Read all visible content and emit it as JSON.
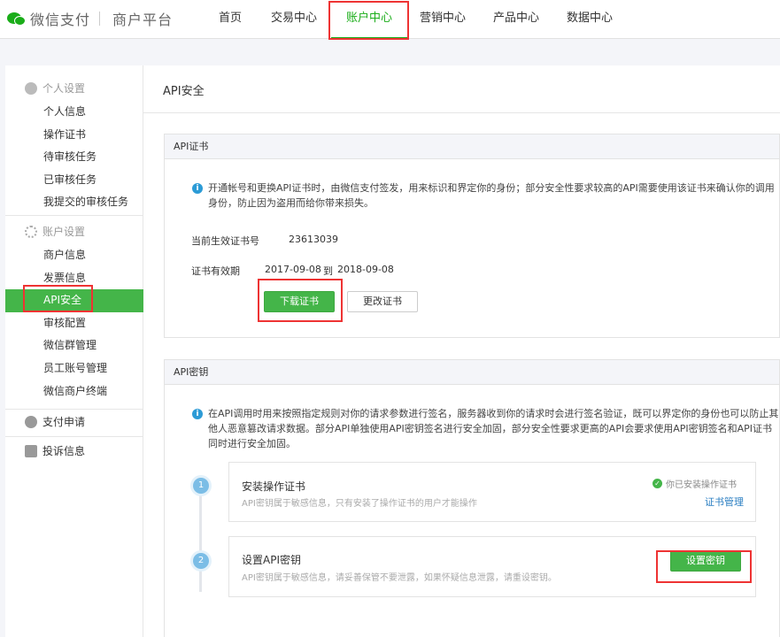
{
  "brand": {
    "name": "微信支付",
    "platform": "商户平台"
  },
  "nav": {
    "items": [
      "首页",
      "交易中心",
      "账户中心",
      "营销中心",
      "产品中心",
      "数据中心"
    ],
    "active_index": 2
  },
  "sidebar": {
    "personal": {
      "title": "个人设置",
      "items": [
        "个人信息",
        "操作证书",
        "待审核任务",
        "已审核任务",
        "我提交的审核任务"
      ]
    },
    "account": {
      "title": "账户设置",
      "items": [
        "商户信息",
        "发票信息",
        "API安全",
        "审核配置",
        "微信群管理",
        "员工账号管理",
        "微信商户终端"
      ],
      "active_index": 2
    },
    "payment_apply": "支付申请",
    "complaint": "投诉信息"
  },
  "main": {
    "title": "API安全",
    "cert": {
      "header": "API证书",
      "note_line1": "开通帐号和更换API证书时，由微信支付签发，用来标识和界定你的身份；部分安全性要求较高的API需要使用该证书来确认你的调用",
      "note_line2": "身份，防止因为盗用而给你带来损失。",
      "serial_label": "当前生效证书号",
      "serial_value": "23613039",
      "valid_label": "证书有效期",
      "valid_from": "2017-09-08",
      "valid_to_word": "到",
      "valid_to": "2018-09-08",
      "download_btn": "下载证书",
      "change_btn": "更改证书"
    },
    "key": {
      "header": "API密钥",
      "note_line1": "在API调用时用来按照指定规则对你的请求参数进行签名，服务器收到你的请求时会进行签名验证，既可以界定你的身份也可以防止其",
      "note_line2": "他人恶意篡改请求数据。部分API单独使用API密钥签名进行安全加固，部分安全性要求更高的API会要求使用API密钥签名和API证书",
      "note_line3": "同时进行安全加固。",
      "step1": {
        "num": "1",
        "title": "安装操作证书",
        "desc": "API密钥属于敏感信息，只有安装了操作证书的用户才能操作",
        "status": "你已安装操作证书",
        "link": "证书管理"
      },
      "step2": {
        "num": "2",
        "title": "设置API密钥",
        "desc": "API密钥属于敏感信息，请妥善保管不要泄露，如果怀疑信息泄露，请重设密钥。",
        "button": "设置密钥"
      }
    }
  },
  "colors": {
    "brand_green": "#1aad19",
    "active_green": "#44b549",
    "highlight_red": "#e33333",
    "info_blue": "#2c9bd6"
  }
}
